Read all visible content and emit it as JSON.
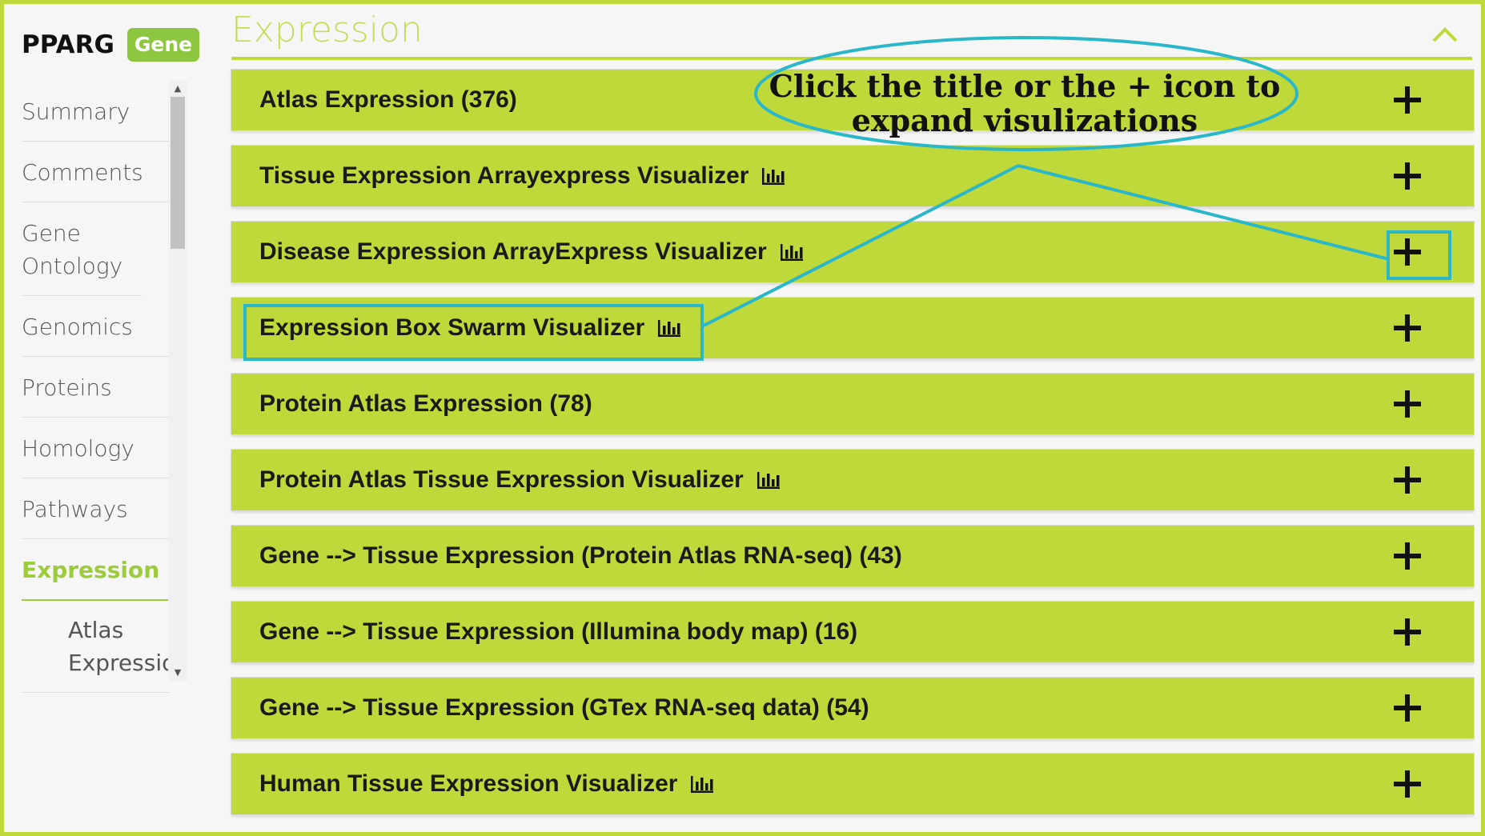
{
  "sidebar": {
    "gene_symbol": "PPARG",
    "badge": "Gene",
    "items": [
      {
        "label": "Summary"
      },
      {
        "label": "Comments"
      },
      {
        "label": "Gene Ontology"
      },
      {
        "label": "Genomics"
      },
      {
        "label": "Proteins"
      },
      {
        "label": "Homology"
      },
      {
        "label": "Pathways"
      },
      {
        "label": "Expression",
        "active": true
      }
    ],
    "sub_item": "Atlas Expression"
  },
  "main": {
    "section_title": "Expression",
    "panels": [
      {
        "title": "Atlas Expression (376)",
        "chart_icon": false
      },
      {
        "title": "Tissue Expression Arrayexpress Visualizer",
        "chart_icon": true
      },
      {
        "title": "Disease Expression ArrayExpress Visualizer",
        "chart_icon": true
      },
      {
        "title": "Expression Box Swarm Visualizer",
        "chart_icon": true
      },
      {
        "title": "Protein Atlas Expression (78)",
        "chart_icon": false
      },
      {
        "title": "Protein Atlas Tissue Expression Visualizer",
        "chart_icon": true
      },
      {
        "title": "Gene --> Tissue Expression (Protein Atlas RNA-seq) (43)",
        "chart_icon": false
      },
      {
        "title": "Gene --> Tissue Expression (Illumina body map) (16)",
        "chart_icon": false
      },
      {
        "title": "Gene --> Tissue Expression (GTex RNA-seq data) (54)",
        "chart_icon": false
      },
      {
        "title": "Human Tissue Expression Visualizer",
        "chart_icon": true
      }
    ]
  },
  "annotation": {
    "line1": "Click the title or the + icon to",
    "line2": "expand visulizations"
  },
  "colors": {
    "accent": "#bfd93a",
    "badge": "#8dc63f",
    "callout": "#2ab7c9",
    "active_nav": "#9ccc3a"
  }
}
